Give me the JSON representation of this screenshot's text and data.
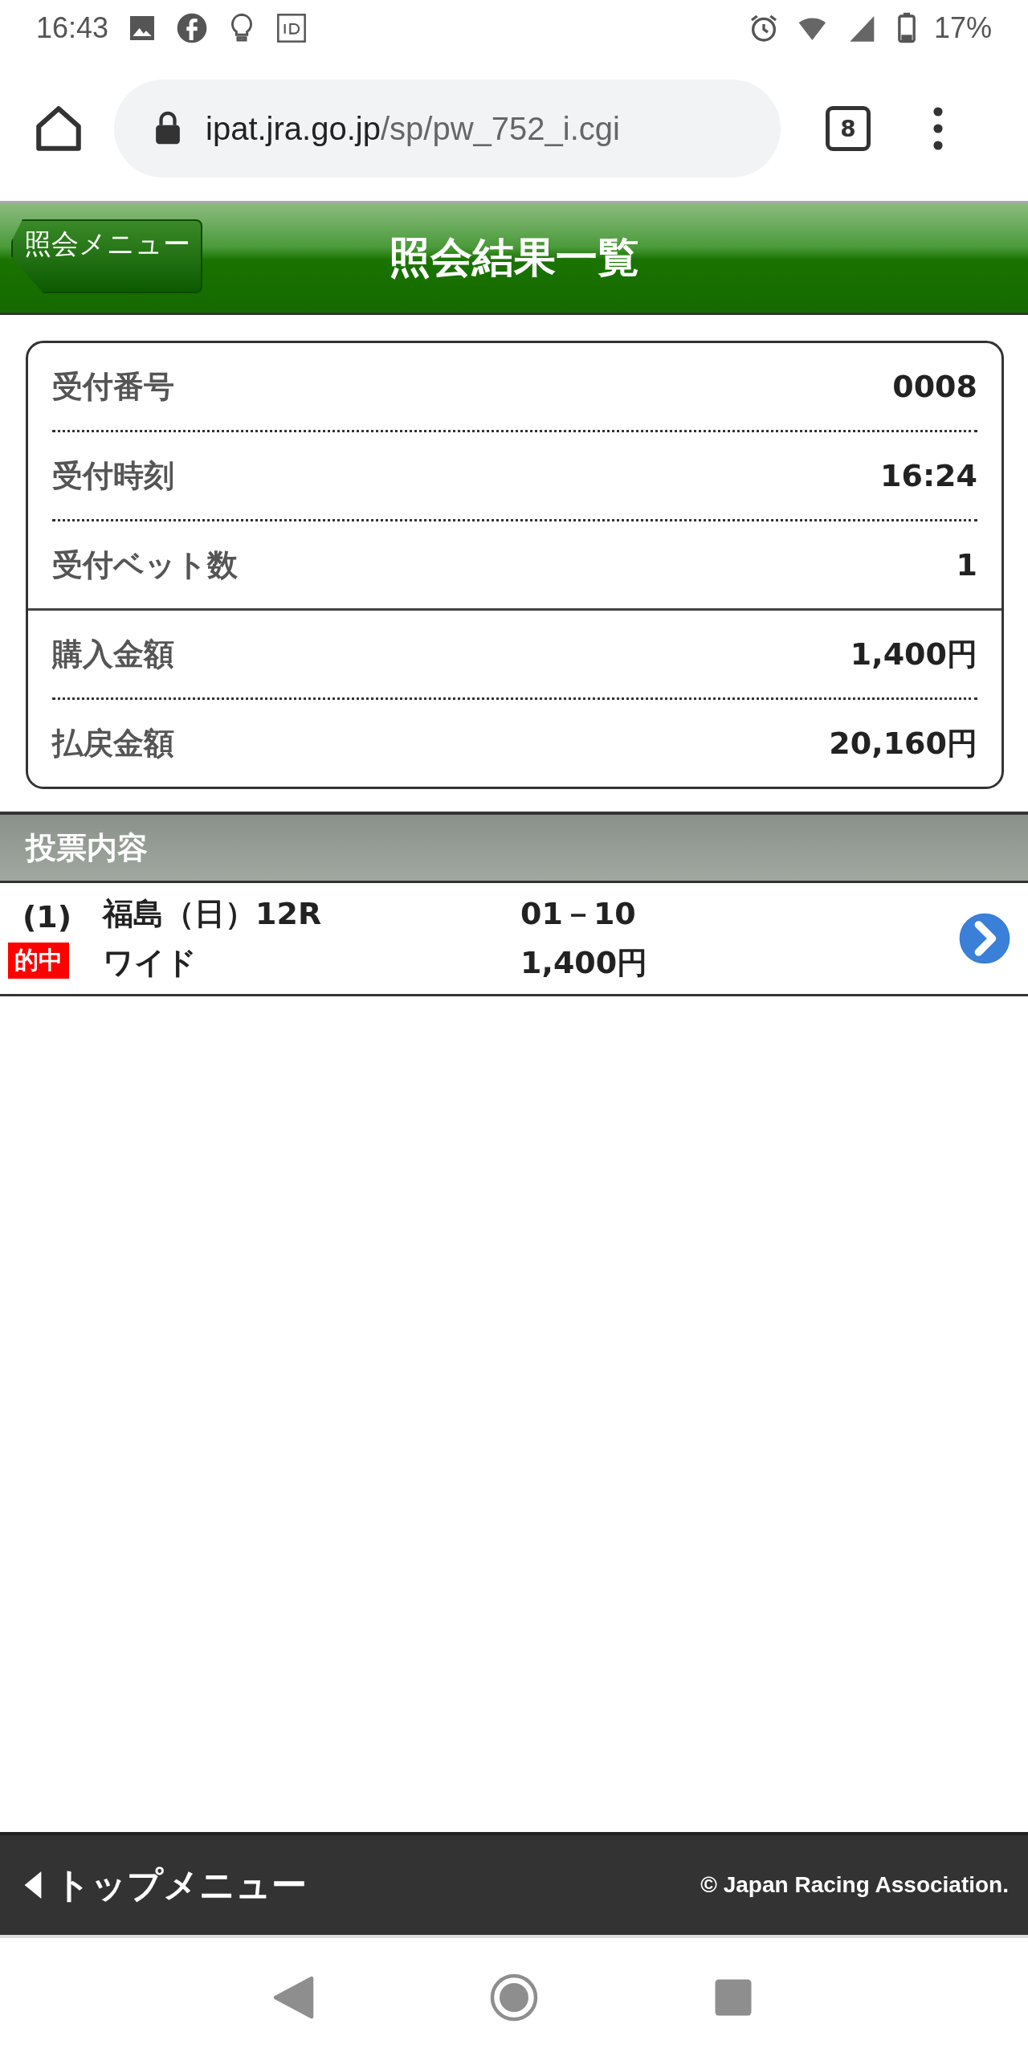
{
  "status_bar": {
    "time": "16:43",
    "battery": "17%"
  },
  "browser": {
    "url_host": "ipat.jra.go.jp",
    "url_path": "/sp/pw_752_i.cgi",
    "tab_count": "8"
  },
  "header": {
    "back_button": "照会メニュー",
    "title": "照会結果一覧"
  },
  "summary": {
    "groups": [
      [
        {
          "label": "受付番号",
          "value": "0008"
        },
        {
          "label": "受付時刻",
          "value": "16:24"
        },
        {
          "label": "受付ベット数",
          "value": "1"
        }
      ],
      [
        {
          "label": "購入金額",
          "value": "1,400円"
        },
        {
          "label": "払戻金額",
          "value": "20,160円"
        }
      ]
    ]
  },
  "section": {
    "title": "投票内容"
  },
  "bets": [
    {
      "number": "(1)",
      "venue": "福島（日）12R",
      "combination": "01－10",
      "hit": true,
      "badge": "的中",
      "bet_type": "ワイド",
      "amount": "1,400円"
    }
  ],
  "footer": {
    "top_menu": "トップメニュー",
    "copyright": "© Japan Racing Association."
  }
}
